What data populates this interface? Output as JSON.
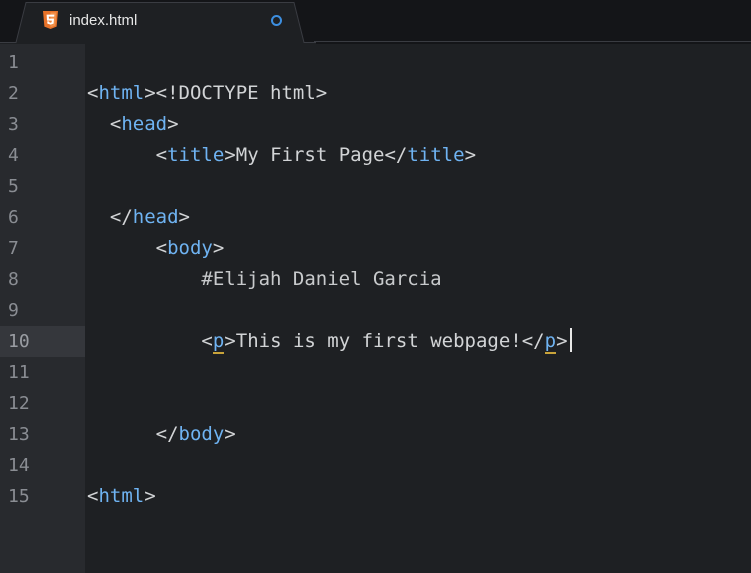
{
  "tab": {
    "filename": "index.html",
    "icon": "html5-icon",
    "unsaved_indicator": "dirty-dot-icon"
  },
  "gutter": {
    "line_numbers": [
      "1",
      "2",
      "3",
      "4",
      "5",
      "6",
      "7",
      "8",
      "9",
      "10",
      "11",
      "12",
      "13",
      "14",
      "15"
    ],
    "current_line": "10"
  },
  "code": {
    "l1_text": "<!DOCTYPE html>",
    "l2_open": "<",
    "l2_tag": "html",
    "l2_close": ">",
    "l3_open": "<",
    "l3_tag": "head",
    "l3_close": ">",
    "l4_open1": "<",
    "l4_tag1": "title",
    "l4_close1": ">",
    "l4_content": "My First Page",
    "l4_open2": "</",
    "l4_tag2": "title",
    "l4_close2": ">",
    "l6_open": "</",
    "l6_tag": "head",
    "l6_close": ">",
    "l7_open": "<",
    "l7_tag": "body",
    "l7_close": ">",
    "l8_text": "#Elijah Daniel Garcia",
    "l10_open1": "<",
    "l10_tag1": "p",
    "l10_close1": ">",
    "l10_content": "This is my first webpage!",
    "l10_open2": "</",
    "l10_tag2": "p",
    "l10_close2": ">",
    "l13_open": "</",
    "l13_tag": "body",
    "l13_close": ">",
    "l15_open": "<",
    "l15_tag": "html",
    "l15_close": ">"
  },
  "colors": {
    "background": "#1e2023",
    "gutter": "#282a2e",
    "tag": "#6fb3f2",
    "text": "#d2d4d6",
    "dirty_dot": "#3d8fe0",
    "html5_icon": "#e8732a",
    "bracket_match": "#c8a33a"
  }
}
